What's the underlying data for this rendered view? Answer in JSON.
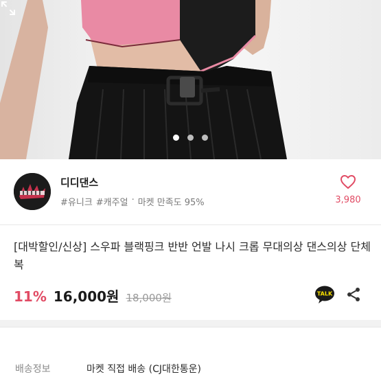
{
  "gallery": {
    "dot_count": 3,
    "active_index": 0,
    "expand_icon": "expand-icon"
  },
  "shop": {
    "name": "디디댄스",
    "logo_icon": "shop-logo",
    "tags": [
      "#유니크",
      "#캐주얼",
      "·",
      "마켓 만족도 95%"
    ],
    "like_count": "3,980",
    "like_icon": "heart-outline-icon"
  },
  "product": {
    "title": "[대박할인/신상] 스우파 블랙핑크 반반 언발 나시 크롭 무대의상 댄스의상 단체복",
    "discount": "11%",
    "price": "16,000원",
    "original_price": "18,000원",
    "talk_label": "TALK",
    "share_icon": "share-icon"
  },
  "shipping": {
    "label": "배송정보",
    "value": "마켓 직접 배송 (CJ대한통운)"
  },
  "colors": {
    "accent": "#e14b64",
    "pink_top": "#e98aa4",
    "black": "#1a1a1a",
    "talk_yellow": "#f9e000"
  }
}
